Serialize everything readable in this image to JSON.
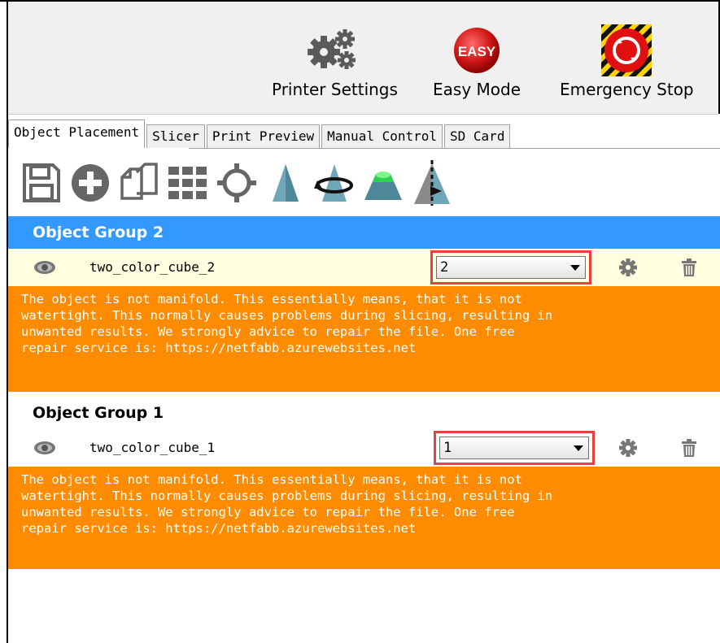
{
  "header": {
    "buttons": [
      {
        "label": "Printer Settings",
        "icon": "gears-icon"
      },
      {
        "label": "Easy Mode",
        "icon": "easy-mode-icon",
        "badge": "EASY"
      },
      {
        "label": "Emergency Stop",
        "icon": "emergency-stop-icon"
      }
    ]
  },
  "tabs": [
    "Object Placement",
    "Slicer",
    "Print Preview",
    "Manual Control",
    "SD Card"
  ],
  "active_tab": "Object Placement",
  "toolbar": [
    {
      "icon": "save-icon"
    },
    {
      "icon": "add-icon"
    },
    {
      "icon": "copy-icon"
    },
    {
      "icon": "autoposition-grid-icon"
    },
    {
      "icon": "center-object-icon"
    },
    {
      "icon": "scale-icon"
    },
    {
      "icon": "rotate-icon"
    },
    {
      "icon": "drop-to-bed-icon"
    },
    {
      "icon": "mirror-icon"
    }
  ],
  "groups": [
    {
      "title": "Object Group 2",
      "object": {
        "name": "two_color_cube_2",
        "extruder": "2"
      },
      "warning": "The object is not manifold. This essentially means, that it is not\nwatertight. This normally causes problems during slicing, resulting in\nunwanted results. We strongly advice to repair the file. One free\nrepair service is: https://netfabb.azurewebsites.net"
    },
    {
      "title": "Object Group 1",
      "object": {
        "name": "two_color_cube_1",
        "extruder": "1"
      },
      "warning": "The object is not manifold. This essentially means, that it is not\nwatertight. This normally causes problems during slicing, resulting in\nunwanted results. We strongly advice to repair the file. One free\nrepair service is: https://netfabb.azurewebsites.net"
    }
  ],
  "colors": {
    "selected_group": "#3399ff",
    "selected_row": "#ffffe0",
    "warning": "#ff8c00",
    "highlight_box": "#e8403a"
  }
}
